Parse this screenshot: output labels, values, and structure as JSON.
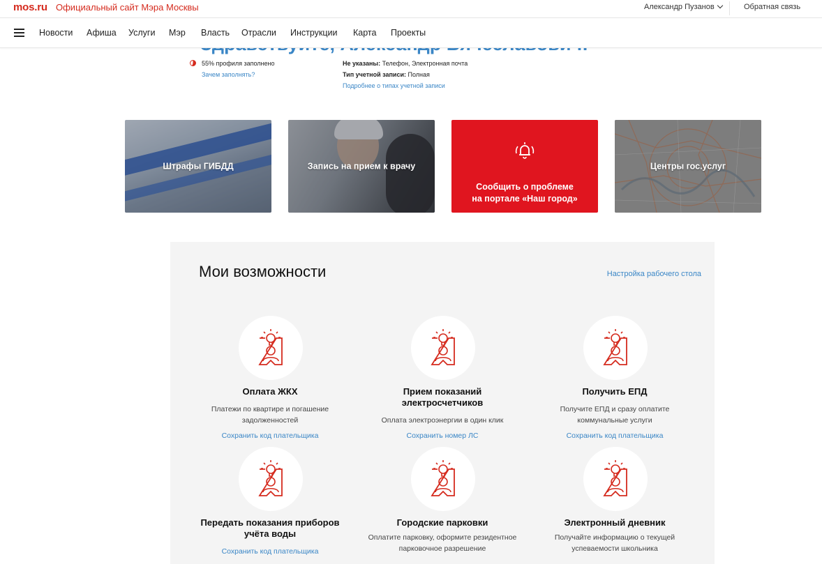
{
  "header": {
    "logo": "mos.ru",
    "site_title": "Официальный сайт Мэра Москвы",
    "user_name": "Александр Пузанов",
    "feedback": "Обратная связь"
  },
  "nav": {
    "items": [
      "Новости",
      "Афиша",
      "Услуги",
      "Мэр",
      "Власть",
      "Отрасли",
      "Инструкции",
      "Карта",
      "Проекты"
    ]
  },
  "profile": {
    "greeting": "Здравствуйте, Александр Вячеславович!",
    "fill_percent": 55,
    "fill_text": "55% профиля заполнено",
    "fill_link": "Зачем заполнять?",
    "missing_label": "Не указаны:",
    "missing_value": " Телефон, Электронная почта",
    "account_type_label": "Тип учетной записи:",
    "account_type_value": " Полная",
    "account_types_link": "Подробнее о типах учетной записи"
  },
  "tiles": [
    {
      "label": "Штрафы ГИБДД"
    },
    {
      "label": "Запись на прием к врачу"
    },
    {
      "label_line1": "Сообщить о проблеме",
      "label_line2": "на портале «Наш город»"
    },
    {
      "label": "Центры гос.услуг"
    }
  ],
  "capabilities": {
    "title": "Мои возможности",
    "settings_link": "Настройка рабочего стола",
    "cards": [
      {
        "title": "Оплата ЖКХ",
        "desc": "Платежи по квартире и погашение задолженностей",
        "action": "Сохранить код плательщика"
      },
      {
        "title": "Прием показаний электросчетчиков",
        "desc": "Оплата электроэнергии в один клик",
        "action": "Сохранить номер ЛС"
      },
      {
        "title": "Получить ЕПД",
        "desc": "Получите ЕПД и сразу оплатите коммунальные услуги",
        "action": "Сохранить код плательщика"
      },
      {
        "title": "Передать показания приборов учёта воды",
        "desc": "",
        "action": "Сохранить код плательщика"
      },
      {
        "title": "Городские парковки",
        "desc": "Оплатите парковку, оформите резидентное парковочное разрешение",
        "action": ""
      },
      {
        "title": "Электронный дневник",
        "desc": "Получайте информацию о текущей успеваемости школьника",
        "action": ""
      }
    ]
  },
  "colors": {
    "brand_red": "#d52b1e",
    "link_blue": "#3a86c6",
    "panel_bg": "#f4f4f4"
  },
  "icons": {
    "menu": "hamburger-icon",
    "user_dropdown": "chevron-down-icon",
    "profile_progress": "pie-progress-icon",
    "problem_tile": "alarm-bell-icon",
    "service": "id-card-lightbulb-icon"
  }
}
